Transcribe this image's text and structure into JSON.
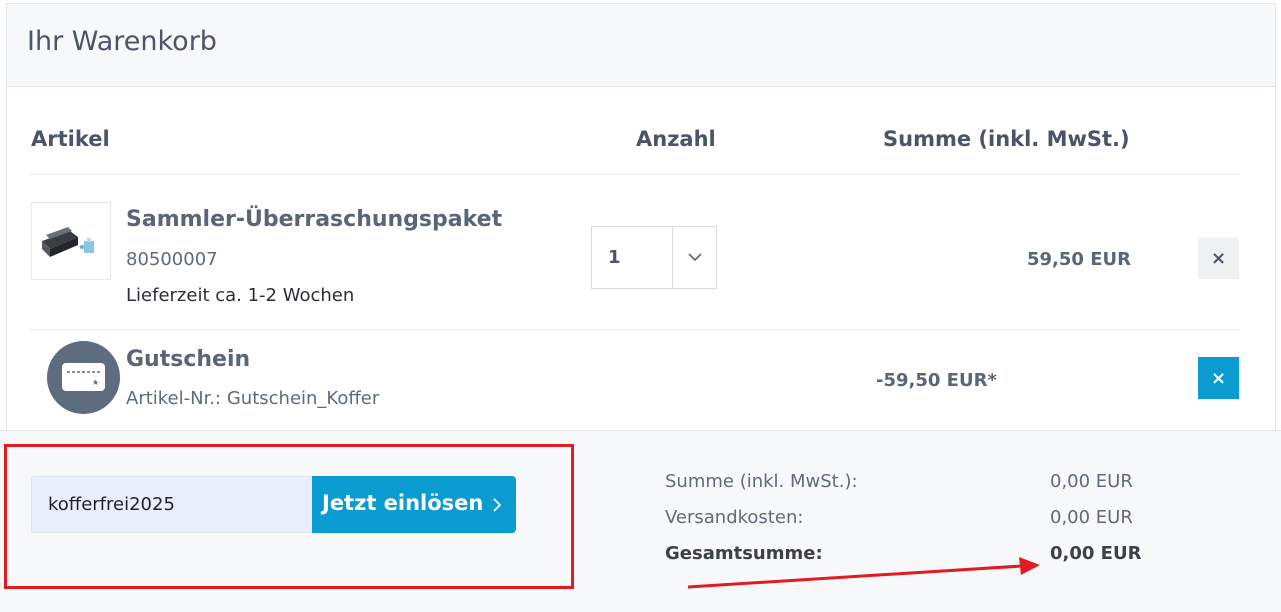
{
  "cart": {
    "title": "Ihr Warenkorb"
  },
  "columns": {
    "artikel": "Artikel",
    "anzahl": "Anzahl",
    "summe": "Summe (inkl. MwSt.)"
  },
  "items": [
    {
      "name": "Sammler-Überraschungspaket",
      "sku": "80500007",
      "delivery": "Lieferzeit ca. 1-2 Wochen",
      "quantity": "1",
      "price": "59,50 EUR",
      "remove_icon": "×",
      "thumbnail_icon": "case-product-icon"
    },
    {
      "name": "Gutschein",
      "sku": "Artikel-Nr.: Gutschein_Koffer",
      "price": "-59,50 EUR*",
      "remove_icon": "×",
      "icon": "voucher-card-icon"
    }
  ],
  "coupon": {
    "value": "kofferfrei2025",
    "button_label": "Jetzt einlösen"
  },
  "totals": {
    "subtotal_label": "Summe (inkl. MwSt.):",
    "subtotal_value": "0,00 EUR",
    "shipping_label": "Versandkosten:",
    "shipping_value": "0,00 EUR",
    "total_label": "Gesamtsumme:",
    "total_value": "0,00 EUR"
  },
  "colors": {
    "accent": "#0a9bd1",
    "annotation": "#e01b22"
  }
}
